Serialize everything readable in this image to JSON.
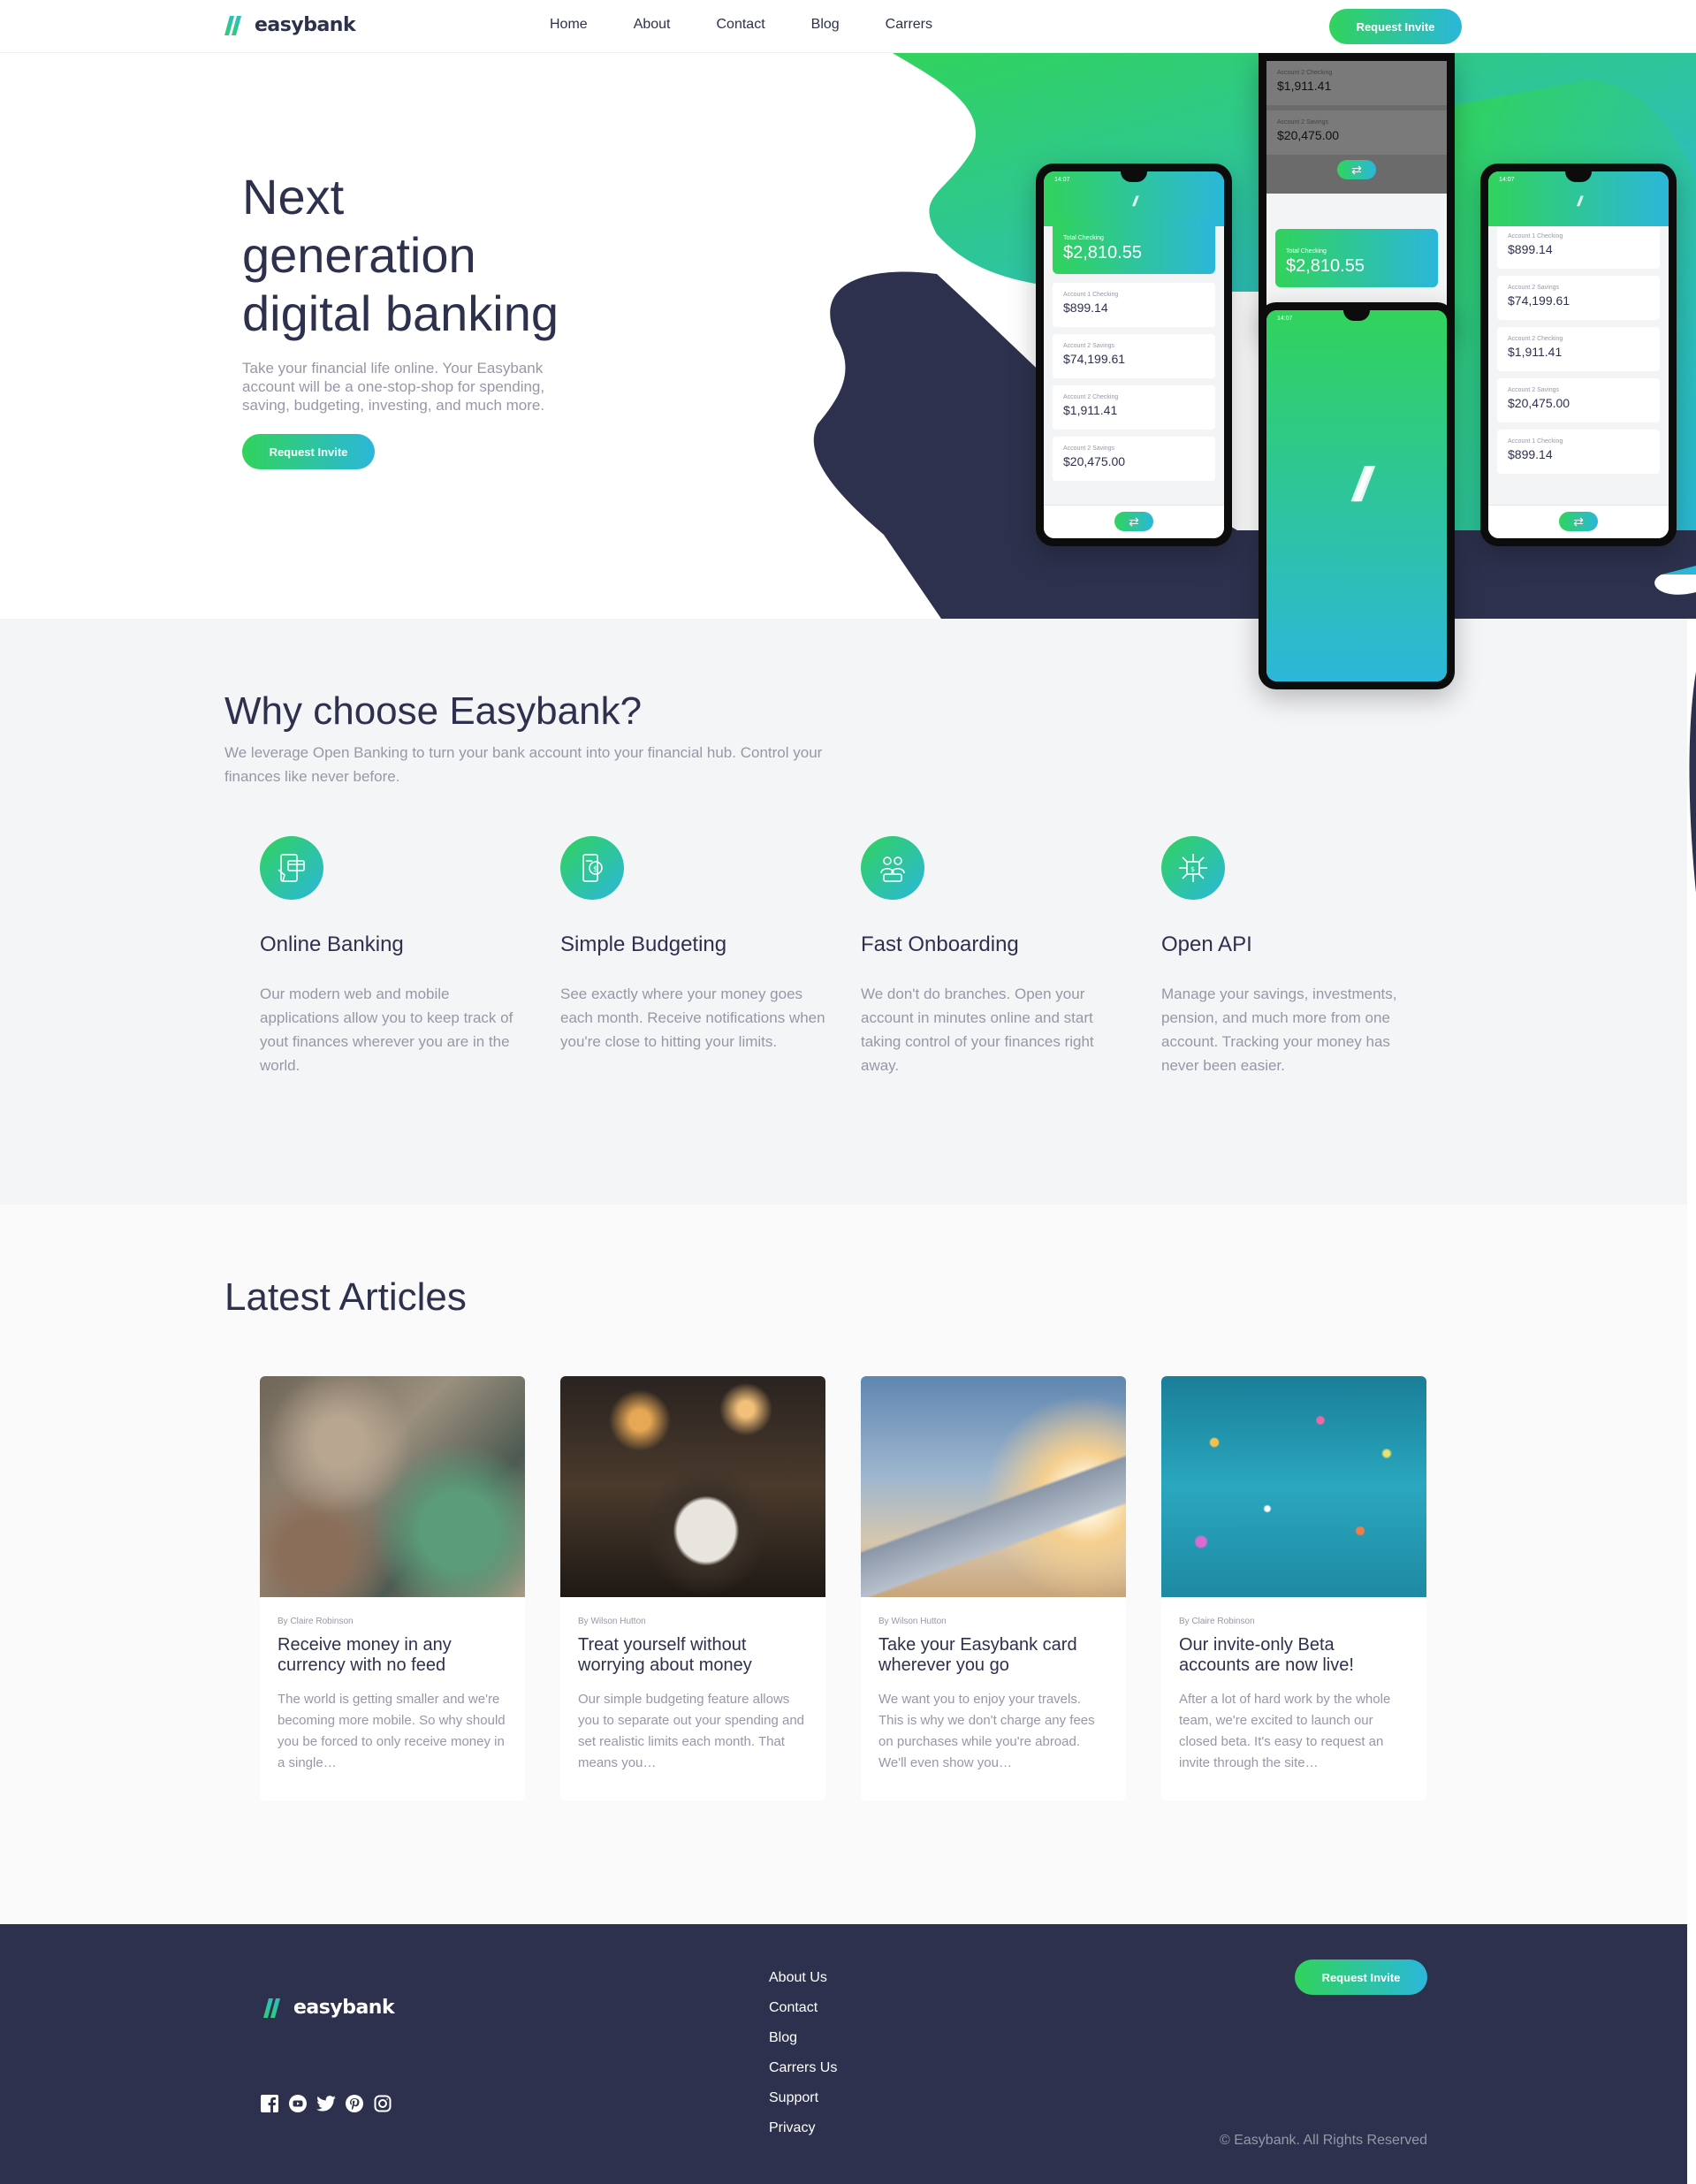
{
  "colors": {
    "dark_blue": "#2d314d",
    "lime_green": "#31d35c",
    "bright_cyan": "#2bb7da",
    "grayish_blue": "#9698a6"
  },
  "brand": {
    "name": "easybank"
  },
  "nav": {
    "links": [
      "Home",
      "About",
      "Contact",
      "Blog",
      "Carrers"
    ],
    "cta": "Request Invite"
  },
  "hero": {
    "title_lines": [
      "Next",
      "generation",
      "digital banking"
    ],
    "description": "Take your financial life online. Your Easybank account will be a one-stop-shop for spending, saving, budgeting, investing, and much more.",
    "cta": "Request Invite"
  },
  "phones": {
    "status_time": "14:07",
    "total_label": "Total Checking",
    "total_amount": "$2,810.55",
    "accounts": [
      {
        "label": "Account 1 Checking",
        "amount": "$899.14"
      },
      {
        "label": "Account 2 Savings",
        "amount": "$74,199.61"
      },
      {
        "label": "Account 2 Checking",
        "amount": "$1,911.41"
      },
      {
        "label": "Account 2 Savings",
        "amount": "$20,475.00"
      },
      {
        "label": "Account 1 Checking",
        "amount": "$899.14"
      }
    ]
  },
  "features": {
    "title": "Why choose Easybank?",
    "subtitle": "We leverage Open Banking to turn your bank account into your financial hub. Control your finances like never before.",
    "items": [
      {
        "icon": "online-banking-icon",
        "title": "Online Banking",
        "text": "Our modern web and mobile applications allow you to keep track of yout finances wherever you are in the world."
      },
      {
        "icon": "budgeting-icon",
        "title": "Simple Budgeting",
        "text": "See exactly where your money goes each month. Receive notifications when you're close to hitting your limits."
      },
      {
        "icon": "onboarding-icon",
        "title": "Fast Onboarding",
        "text": "We don't do branches. Open your account in minutes online and start taking control of your finances right away."
      },
      {
        "icon": "api-icon",
        "title": "Open API",
        "text": "Manage your savings, investments, pension, and much more from one account. Tracking your money has never been easier."
      }
    ]
  },
  "articles": {
    "title": "Latest Articles",
    "items": [
      {
        "image": "currency-photo",
        "author": "By Claire Robinson",
        "title": "Receive money in any currency with no feed",
        "text": "The world is getting smaller and we're becoming more mobile. So why should you be forced to only receive money in a single…"
      },
      {
        "image": "restaurant-photo",
        "author": "By Wilson Hutton",
        "title": "Treat yourself without worrying about money",
        "text": "Our simple budgeting feature allows you to separate out your spending and set realistic limits each month. That means you…"
      },
      {
        "image": "plane-photo",
        "author": "By Wilson Hutton",
        "title": "Take your Easybank card wherever you go",
        "text": "We want you to enjoy your travels. This is why we don't charge any fees on purchases while you're abroad. We'll even show you…"
      },
      {
        "image": "confetti-photo",
        "author": "By Claire Robinson",
        "title": "Our invite-only Beta accounts are now live!",
        "text": "After a lot of hard work by the whole team, we're excited to launch our closed beta. It's easy to request an invite through the site…"
      }
    ]
  },
  "footer": {
    "links": [
      "About Us",
      "Contact",
      "Blog",
      "Carrers Us",
      "Support",
      "Privacy"
    ],
    "socials": [
      "facebook-icon",
      "youtube-icon",
      "twitter-icon",
      "pinterest-icon",
      "instagram-icon"
    ],
    "cta": "Request Invite",
    "copyright": "© Easybank. All Rights Reserved"
  }
}
